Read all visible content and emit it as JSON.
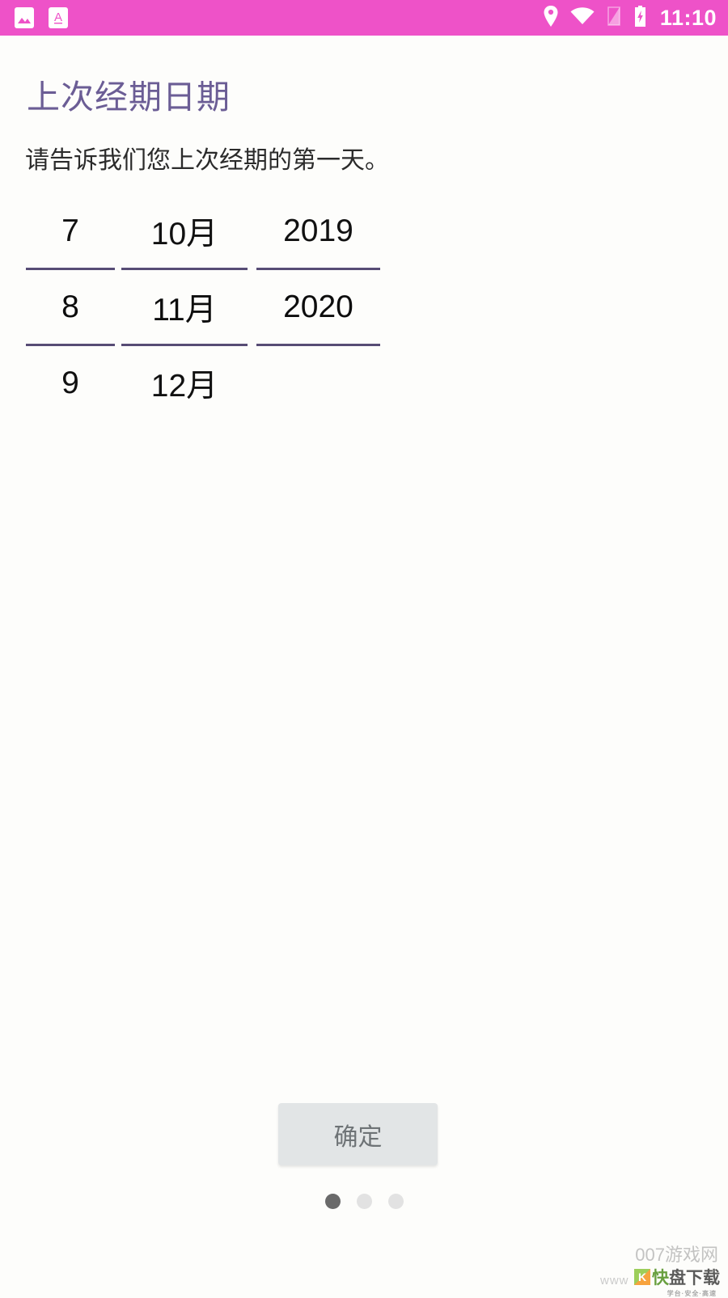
{
  "status_bar": {
    "background_color": "#ee52c8",
    "time": "11:10",
    "notification_icons": [
      "image-icon",
      "font-text-icon"
    ],
    "system_icons": [
      "location-icon",
      "wifi-icon",
      "sim-off-icon",
      "battery-charging-icon"
    ]
  },
  "screen": {
    "title": "上次经期日期",
    "title_color": "#6b5d95",
    "subtitle": "请告诉我们您上次经期的第一天。",
    "background_color": "#fdfdfb"
  },
  "date_picker": {
    "divider_color": "#574c75",
    "columns": [
      {
        "name": "day",
        "previous": "7",
        "selected": "8",
        "next": "9"
      },
      {
        "name": "month",
        "previous": "10月",
        "selected": "11月",
        "next": "12月"
      },
      {
        "name": "year",
        "previous": "2019",
        "selected": "2020",
        "next": ""
      }
    ]
  },
  "confirm_button": {
    "label": "确定",
    "background_color": "#e2e5e6",
    "text_color": "#6e7376"
  },
  "page_indicator": {
    "total": 3,
    "active_index": 0,
    "active_color": "#6a6a6a",
    "inactive_color": "#e2e2e2"
  },
  "watermark": {
    "site": "007游戏网",
    "url": "www",
    "logo_letter": "K",
    "brand_first": "快",
    "brand_rest": "盘下载",
    "tagline": "学台·安全·高速"
  }
}
